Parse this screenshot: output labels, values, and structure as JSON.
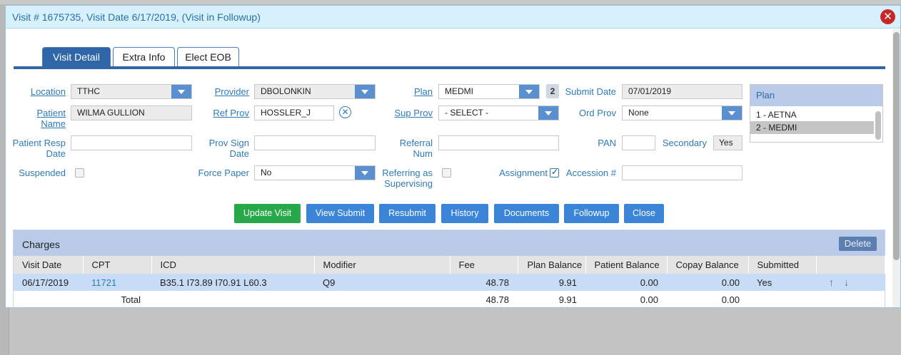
{
  "dialog": {
    "title": "Visit # 1675735, Visit Date 6/17/2019, (Visit in Followup)",
    "close_icon": "close-x-icon"
  },
  "tabs": [
    {
      "label": "Visit Detail",
      "active": true
    },
    {
      "label": "Extra Info",
      "active": false
    },
    {
      "label": "Elect EOB",
      "active": false
    }
  ],
  "form": {
    "location": {
      "label": "Location",
      "value": "TTHC"
    },
    "patient_name": {
      "label_1": "Patient",
      "label_2": "Name",
      "value": "WILMA  GULLION"
    },
    "patient_resp_date": {
      "label_1": "Patient Resp",
      "label_2": "Date",
      "value": ""
    },
    "suspended": {
      "label": "Suspended",
      "checked": false
    },
    "provider": {
      "label": "Provider",
      "value": "DBOLONKIN"
    },
    "ref_prov": {
      "label": "Ref Prov",
      "value": "HOSSLER_J"
    },
    "prov_sign_date": {
      "label_1": "Prov Sign",
      "label_2": "Date",
      "value": ""
    },
    "force_paper": {
      "label": "Force Paper",
      "value": "No"
    },
    "plan": {
      "label": "Plan",
      "value": "MEDMI",
      "badge": "2"
    },
    "sup_prov": {
      "label": "Sup Prov",
      "value": "- SELECT -"
    },
    "referral_num": {
      "label_1": "Referral",
      "label_2": "Num",
      "value": ""
    },
    "referring_as_supervising": {
      "label_1": "Referring as",
      "label_2": "Supervising",
      "checked": false
    },
    "submit_date": {
      "label": "Submit Date",
      "value": "07/01/2019"
    },
    "ord_prov": {
      "label": "Ord Prov",
      "value": "None"
    },
    "pan": {
      "label": "PAN",
      "value": ""
    },
    "secondary": {
      "label": "Secondary",
      "value": "Yes"
    },
    "assignment": {
      "label": "Assignment",
      "checked": true
    },
    "accession": {
      "label": "Accession #",
      "value": ""
    }
  },
  "plan_list": {
    "header": "Plan",
    "options": [
      "1 - AETNA",
      "2 - MEDMI"
    ],
    "selected": "2 - MEDMI"
  },
  "buttons": {
    "update_visit": "Update Visit",
    "view_submit": "View Submit",
    "resubmit": "Resubmit",
    "history": "History",
    "documents": "Documents",
    "followup": "Followup",
    "close": "Close"
  },
  "charges": {
    "title": "Charges",
    "delete_label": "Delete",
    "columns": [
      "Visit Date",
      "CPT",
      "ICD",
      "Modifier",
      "Fee",
      "Plan Balance",
      "Patient Balance",
      "Copay Balance",
      "Submitted"
    ],
    "rows": [
      {
        "visit_date": "06/17/2019",
        "cpt": "11721",
        "icd": "B35.1 I73.89 I70.91 L60.3",
        "modifier": "Q9",
        "fee": "48.78",
        "plan_balance": "9.91",
        "patient_balance": "0.00",
        "copay_balance": "0.00",
        "submitted": "Yes"
      }
    ],
    "total": {
      "label": "Total",
      "fee": "48.78",
      "plan_balance": "9.91",
      "patient_balance": "0.00",
      "copay_balance": "0.00"
    }
  },
  "colors": {
    "accent": "#2e66a7",
    "link": "#2f7bb5",
    "button": "#3b85d8",
    "button_primary": "#27a94a",
    "selected_row": "#c8dcf6"
  }
}
